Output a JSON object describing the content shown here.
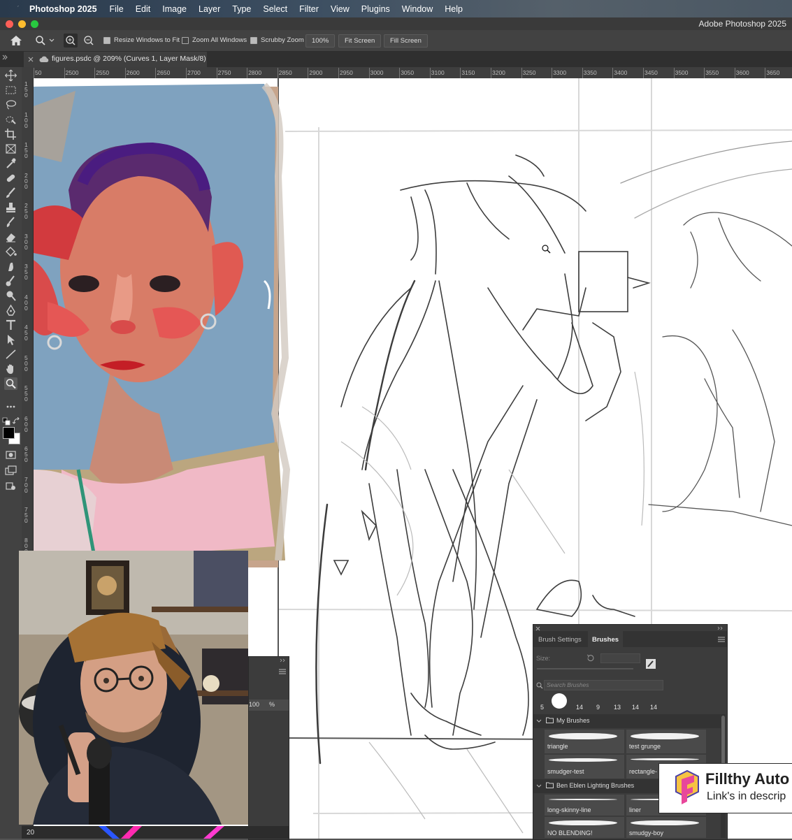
{
  "menubar": {
    "app_name": "Photoshop 2025",
    "items": [
      "File",
      "Edit",
      "Image",
      "Layer",
      "Type",
      "Select",
      "Filter",
      "View",
      "Plugins",
      "Window",
      "Help"
    ]
  },
  "titlebar": {
    "title": "Adobe Photoshop 2025"
  },
  "options": {
    "resize_windows": "Resize Windows to Fit",
    "zoom_all": "Zoom All Windows",
    "scrubby": "Scrubby Zoom",
    "zoom_value": "100%",
    "fit_screen": "Fit Screen",
    "fill_screen": "Fill Screen"
  },
  "doc_tab": {
    "title": "figures.psdc @ 209% (Curves 1, Layer Mask/8)"
  },
  "ruler": {
    "h_labels": [
      "50",
      "2500",
      "2550",
      "2600",
      "2650",
      "2700",
      "2750",
      "2800",
      "2850",
      "2900",
      "2950",
      "3000",
      "3050",
      "3100",
      "3150",
      "3200",
      "3250",
      "3300",
      "3350",
      "3400",
      "3450",
      "3500",
      "3550",
      "3600",
      "3650"
    ],
    "v_labels": [
      "1 5 0",
      "1 0 0",
      "1 5 0",
      "2 0 0",
      "2 5 0",
      "3 0 0",
      "3 5 0",
      "4 0 0",
      "4 5 0",
      "5 0 0",
      "5 5 0",
      "6 0 0",
      "6 5 0",
      "7 0 0",
      "7 5 0",
      "8 0 0"
    ]
  },
  "brushes_panel": {
    "tab_settings": "Brush Settings",
    "tab_brushes": "Brushes",
    "size_label": "Size:",
    "search_placeholder": "Search Brushes",
    "recent_sizes": [
      "5",
      "",
      "14",
      "9",
      "13",
      "14",
      "14"
    ],
    "group1": "My Brushes",
    "group1_items": [
      "triangle",
      "test grunge",
      "smudger-test",
      "rectangle-"
    ],
    "group2": "Ben Eblen Lighting Brushes",
    "group2_items": [
      "long-skinny-line",
      "liner",
      "NO BLENDING!",
      "smudgy-boy"
    ]
  },
  "side_panel": {
    "value": "100",
    "unit": "%"
  },
  "promo": {
    "line1": "Fillthy Auto",
    "line2": "Link's in descrip"
  },
  "bottom_left_text": "20",
  "colors": {
    "accent": "#e63a3a",
    "panel": "#3c3c3c",
    "canvas": "#ffffff"
  }
}
